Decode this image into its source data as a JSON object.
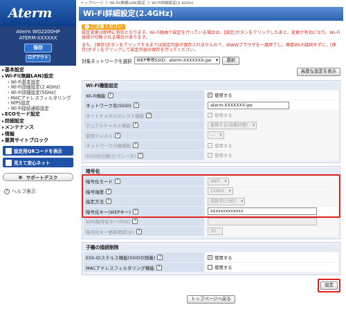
{
  "sidebar": {
    "logo": "Aterm",
    "model": "Aterm  WG2200HP",
    "device_id": "ATERM-XXXXXX",
    "save_label": "保存",
    "logout_label": "ログアウト",
    "nav": [
      {
        "level": 1,
        "label": "基本設定"
      },
      {
        "level": 1,
        "label": "Wi-Fi(無線LAN)設定"
      },
      {
        "level": 2,
        "label": "Wi-Fi基本設定"
      },
      {
        "level": 2,
        "label": "Wi-Fi詳細設定(2.4GHz)"
      },
      {
        "level": 2,
        "label": "Wi-Fi詳細設定(5GHz)"
      },
      {
        "level": 2,
        "label": "MACアドレスフィルタリング"
      },
      {
        "level": 2,
        "label": "WPS設定"
      },
      {
        "level": 2,
        "label": "Wi-Fi接続通知設定"
      },
      {
        "level": 1,
        "label": "ECOモード設定"
      },
      {
        "level": 1,
        "label": "詳細設定"
      },
      {
        "level": 1,
        "label": "メンテナンス"
      },
      {
        "level": 1,
        "label": "情報"
      },
      {
        "level": 1,
        "label": "悪質サイトブロック"
      }
    ],
    "qr_button": "設定用QRコードを表示",
    "anshin_button": "見えて安心ネット",
    "support_button": "サポートデスク",
    "help_label": "ヘルプ表示"
  },
  "main": {
    "breadcrumb": "トップページ ＞ Wi-Fi(無線LAN)設定 ＞ Wi-Fi詳細設定(2.4GHz)",
    "title": "Wi-Fi詳細設定(2.4GHz)",
    "caution_head": "ご注意ください",
    "caution_p1": "設定変更は即時に有効となります。Wi-Fi経由で設定を行っている場合は、[設定]ボタンをクリックしたあと、変更が有効になり、Wi-Fi接続が切断される場合があります。",
    "caution_p2": "また、[保存]ボタンをクリックするまでは設定内容が保存されませんので、WWWブラウザを一度終了し、再度Wi-Fi接続せずに、[保存]ボタンをクリックして設定内容の保存を行ってください。",
    "target_label": "対象ネットワークを選択",
    "target_value": "WEP専用SSID：aterm-XXXXXXX-gw",
    "select_button": "選択",
    "advanced_button": "高度な設定を表示",
    "wifi_section": {
      "title": "Wi-Fi機能設定",
      "rows": [
        {
          "label": "Wi-Fi機能",
          "type": "check",
          "checked": true,
          "value": "使用する"
        },
        {
          "label": "ネットワーク名(SSID)",
          "type": "text",
          "value": "aterm-XXXXXXX-gw"
        },
        {
          "label": "オートチャネルセレクト機能",
          "type": "check",
          "checked": true,
          "value": "使用する"
        },
        {
          "label": "デュアルチャネル機能",
          "type": "select",
          "value": "使用する(自動切替)"
        },
        {
          "label": "使用チャネル",
          "type": "select",
          "value": "---"
        },
        {
          "label": "ネットワーク分離機能",
          "type": "check",
          "checked": true,
          "value": "使用する"
        },
        {
          "label": "SSID内分離(セパレータ)",
          "type": "check",
          "checked": true,
          "value": "使用する"
        }
      ]
    },
    "enc_section": {
      "title": "暗号化",
      "rows": [
        {
          "label": "暗号化モード",
          "type": "select",
          "value": "WEP"
        },
        {
          "label": "暗号強度",
          "type": "select",
          "value": "128bit"
        },
        {
          "label": "指定方法",
          "type": "select",
          "value": "英数字(13桁)"
        },
        {
          "label": "暗号化キー(WEPキー)",
          "type": "text",
          "value": "xxxxxxxxxxxxx"
        },
        {
          "label": "WPA暗号化キー(PSK)",
          "type": "text",
          "value": ""
        },
        {
          "label": "暗号化キー更新間隔(分)",
          "type": "text",
          "value": "30"
        }
      ]
    },
    "child_section": {
      "title": "子機の接続制限",
      "rows": [
        {
          "label": "ESS-IDステルス機能(SSIDの隠蔽)",
          "type": "check",
          "checked": true,
          "value": "使用する"
        },
        {
          "label": "MACアドレスフィルタリング機能",
          "type": "check",
          "checked": false,
          "value": "使用する"
        }
      ]
    },
    "setting_button": "設定",
    "top_page_button": "トップページへ戻る"
  },
  "colors": {
    "brand_blue": "#2d62b0",
    "highlight_red": "#e0201a",
    "caution_orange": "#f4a51c"
  }
}
